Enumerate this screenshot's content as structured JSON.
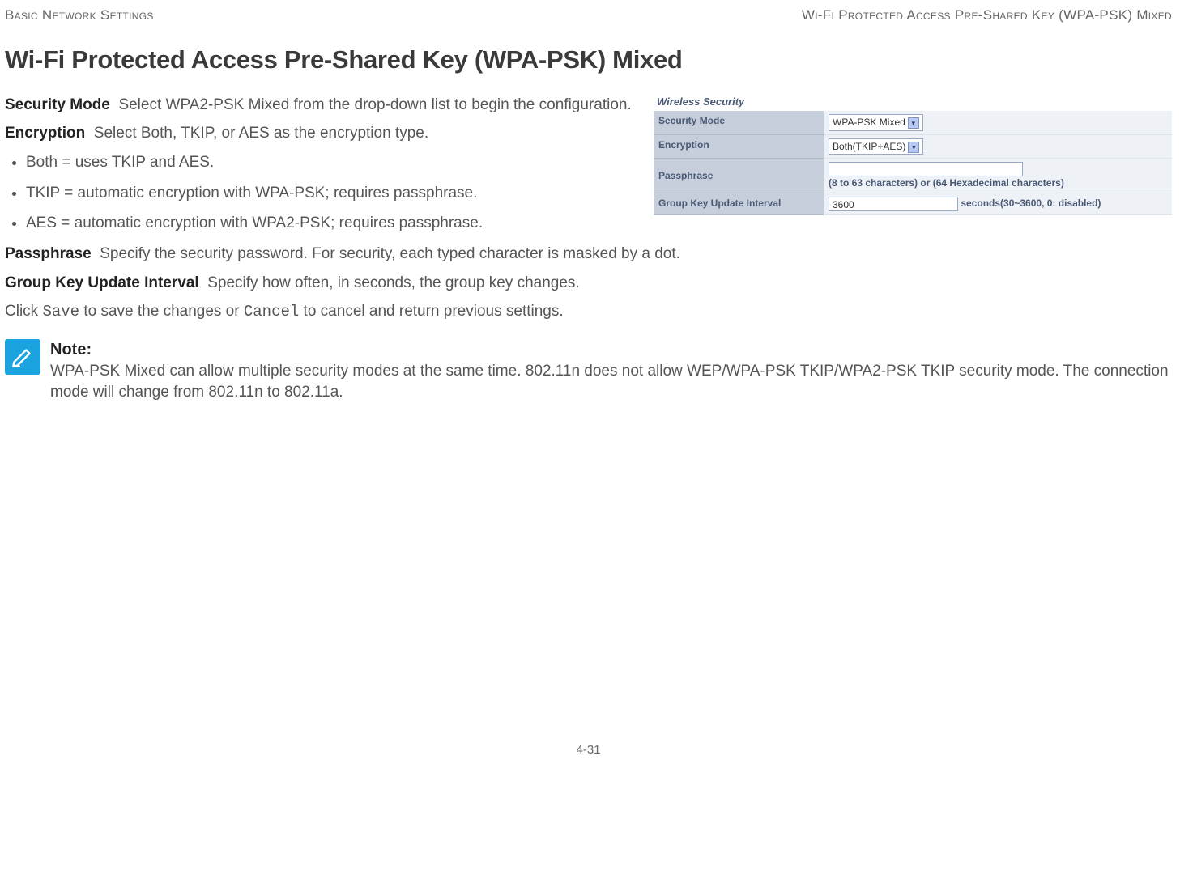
{
  "header": {
    "left": "Basic Network Settings",
    "right": "Wi-Fi Protected Access Pre-Shared Key (WPA-PSK) Mixed"
  },
  "title": "Wi-Fi Protected Access Pre-Shared Key (WPA-PSK) Mixed",
  "figure": {
    "heading": "Wireless Security",
    "rows": {
      "security_mode": {
        "label": "Security Mode",
        "value": "WPA-PSK Mixed"
      },
      "encryption": {
        "label": "Encryption",
        "value": "Both(TKIP+AES)"
      },
      "passphrase": {
        "label": "Passphrase",
        "hint": "(8 to 63 characters) or (64 Hexadecimal characters)"
      },
      "interval": {
        "label": "Group Key Update Interval",
        "value": "3600",
        "suffix": "seconds(30~3600, 0: disabled)"
      }
    }
  },
  "defs": {
    "security_mode": {
      "term": "Security Mode",
      "text": "Select WPA2-PSK Mixed from the drop-down list to begin the configuration."
    },
    "encryption": {
      "term": "Encryption",
      "text": "Select Both, TKIP, or AES as the encryption type."
    },
    "bullets": {
      "both": "Both = uses TKIP and AES.",
      "tkip": "TKIP = automatic encryption with WPA-PSK; requires passphrase.",
      "aes": "AES = automatic encryption with WPA2-PSK; requires passphrase."
    },
    "passphrase": {
      "term": "Passphrase",
      "text": "Specify the security password. For security, each typed character is masked by a dot."
    },
    "group_key": {
      "term": "Group Key Update Interval",
      "text": "Specify how often, in seconds, the group key changes."
    },
    "save_cancel": {
      "pre": "Click ",
      "save": "Save",
      "mid": " to save the changes or ",
      "cancel": "Cancel",
      "post": " to cancel and return previous settings."
    }
  },
  "note": {
    "heading": "Note:",
    "text": "WPA-PSK Mixed can allow multiple security modes at the same time.  802.11n does not allow WEP/WPA-PSK TKIP/WPA2-PSK TKIP security mode. The connection mode will change from 802.11n to 802.11a."
  },
  "page_number": "4-31"
}
